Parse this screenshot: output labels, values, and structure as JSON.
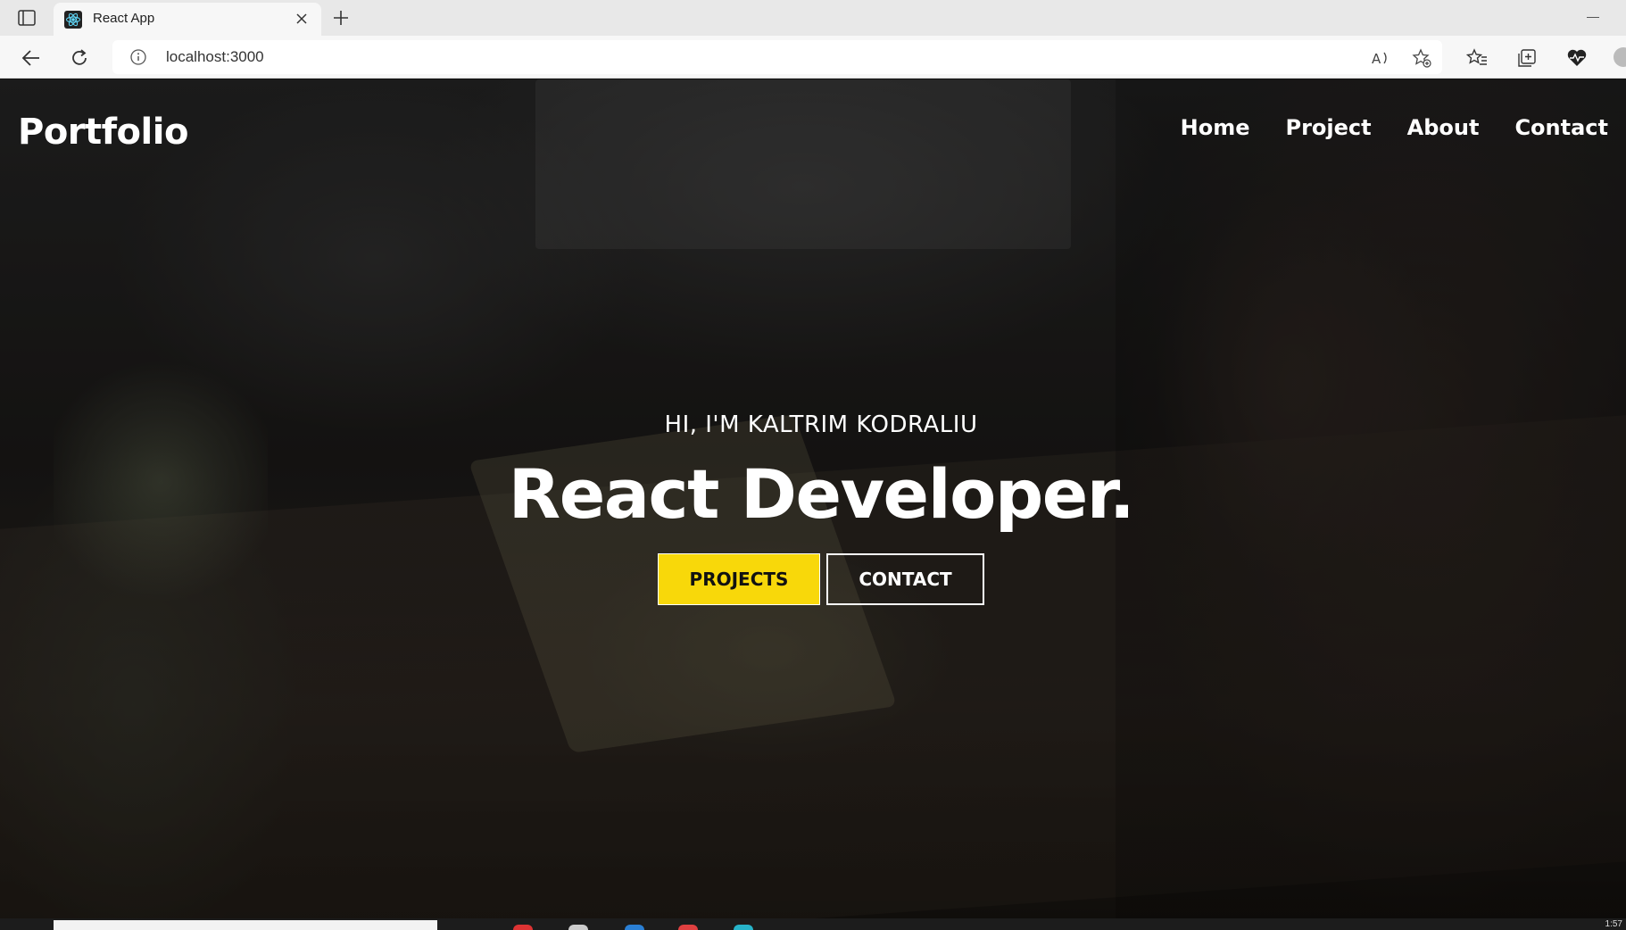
{
  "browser": {
    "tab_title": "React App",
    "url": "localhost:3000"
  },
  "site": {
    "logo": "Portfolio",
    "nav": [
      {
        "label": "Home"
      },
      {
        "label": "Project"
      },
      {
        "label": "About"
      },
      {
        "label": "Contact"
      }
    ],
    "hero_subtitle": "HI, I'M KALTRIM KODRALIU",
    "hero_title": "React Developer.",
    "buttons": {
      "projects": "PROJECTS",
      "contact": "CONTACT"
    },
    "colors": {
      "accent": "#f8d80a",
      "text": "#ffffff"
    }
  },
  "taskbar": {
    "clock": "1:57"
  }
}
